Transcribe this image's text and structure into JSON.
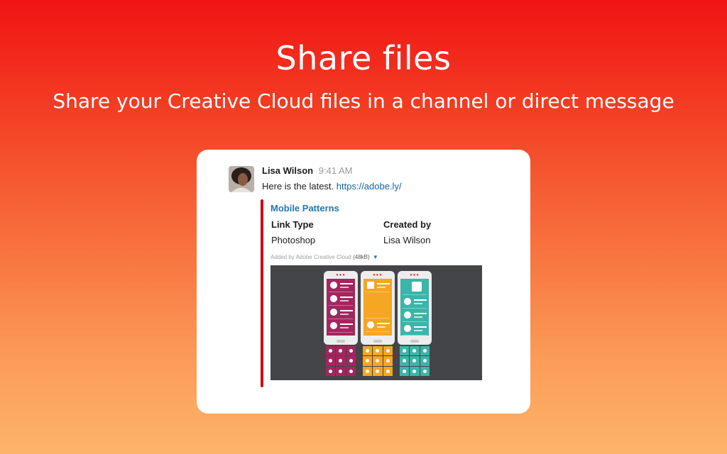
{
  "hero": {
    "title": "Share files",
    "subtitle": "Share your Creative Cloud files in a channel or direct message"
  },
  "message": {
    "sender": "Lisa Wilson",
    "time": "9:41 AM",
    "text": "Here is the latest.",
    "link": "https://adobe.ly/"
  },
  "attachment": {
    "title": "Mobile Patterns",
    "fields": [
      {
        "label": "Link Type",
        "value": "Photoshop"
      },
      {
        "label": "Created by",
        "value": "Lisa Wilson"
      }
    ],
    "meta_prefix": "Added by Adobe Creative Cloud",
    "size": "(48kB)",
    "menu_icon": "caret-down-icon"
  },
  "colors": {
    "accent_red": "#cc0b13",
    "link_blue": "#1f78b4",
    "phone_purple": "#a3265e",
    "phone_orange": "#f5a623",
    "phone_teal": "#3bb5a9"
  }
}
